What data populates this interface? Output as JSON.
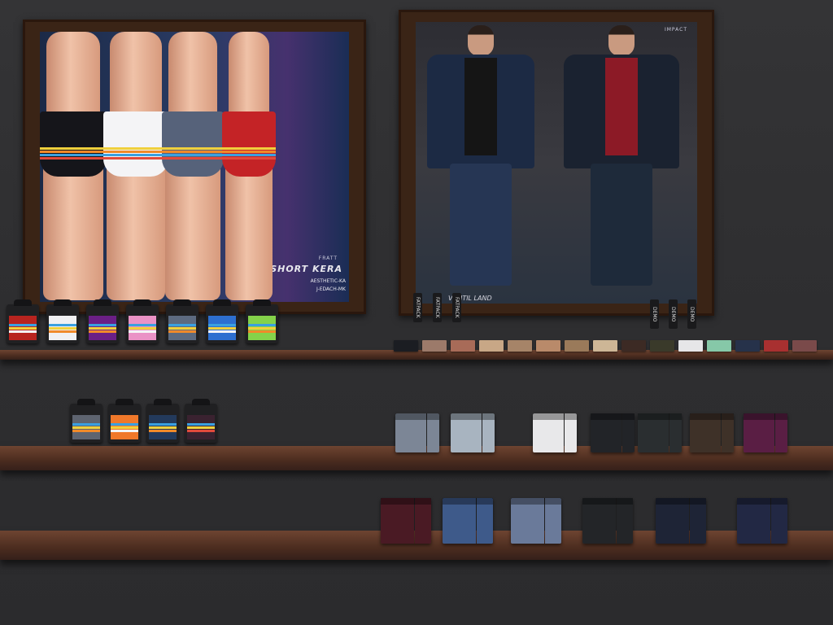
{
  "posters": [
    {
      "id": "short-kera",
      "title": "SHORT KERA",
      "subtitle_1": "AESTHETIC-KA",
      "subtitle_2": "J-EDACH-MK",
      "brand": "FRATT",
      "brief_colors": [
        "#15151a",
        "#f4f4f6",
        "#56627a",
        "#c42326"
      ],
      "stripe_colors": [
        "#f0d03c",
        "#f08a2a",
        "#3aa0e0",
        "#e04a3c"
      ]
    },
    {
      "id": "jeans-jacket",
      "brand": "IMPACT",
      "caption": "VUNTIL LAND",
      "outfits": [
        {
          "jacket": "#1c2a44",
          "shirt": "#151515",
          "jeans": "#263654"
        },
        {
          "jacket": "#1a2230",
          "shirt": "#8c1a26",
          "jeans": "#1e2a3a"
        }
      ]
    }
  ],
  "shelf_1": {
    "boxes": [
      {
        "color": "#b8241f",
        "stripes": [
          "#3aa0e0",
          "#f0d03c",
          "#f4f4f6"
        ]
      },
      {
        "color": "#f0f0f2",
        "stripes": [
          "#3aa0e0",
          "#f0d03c",
          "#f08a2a"
        ]
      },
      {
        "color": "#6a1f86",
        "stripes": [
          "#3aa0e0",
          "#f0d03c",
          "#f08a2a"
        ]
      },
      {
        "color": "#ea92c6",
        "stripes": [
          "#3aa0e0",
          "#f0d03c",
          "#f4f4f6"
        ]
      },
      {
        "color": "#5c6a80",
        "stripes": [
          "#3aa0e0",
          "#f0d03c",
          "#f08a2a"
        ]
      },
      {
        "color": "#2d6fd0",
        "stripes": [
          "#3aa0e0",
          "#f0d03c",
          "#f4f4f6"
        ]
      },
      {
        "color": "#84d24a",
        "stripes": [
          "#3aa0e0",
          "#f0d03c",
          "#f08a2a"
        ]
      }
    ],
    "tags_left": [
      "FATPACK",
      "FATPACK",
      "FATPACK"
    ],
    "tags_right": [
      "DEMO",
      "DEMO",
      "DEMO"
    ],
    "swatches": [
      "#1b1d22",
      "#9c7a6a",
      "#a86b58",
      "#c8a786",
      "#a68468",
      "#b98a6a",
      "#9a7a5a",
      "#cdb696",
      "#3c2a24",
      "#3a3a2a",
      "#e6e6e8",
      "#86c8a8",
      "#26324a",
      "#a83030",
      "#7a4a4a"
    ]
  },
  "shelf_2": {
    "boxes": [
      {
        "color": "#5e6470",
        "stripes": [
          "#3aa0e0",
          "#f0d03c",
          "#f08a2a"
        ]
      },
      {
        "color": "#f0782a",
        "stripes": [
          "#3aa0e0",
          "#f0d03c",
          "#f4f4f6"
        ]
      },
      {
        "color": "#233a5c",
        "stripes": [
          "#3aa0e0",
          "#f0d03c",
          "#f08a2a"
        ]
      },
      {
        "color": "#3a2230",
        "stripes": [
          "#3aa0e0",
          "#f0d03c",
          "#e04a3c"
        ]
      }
    ],
    "packs": [
      "#7c8696",
      "#a8b4c0",
      "#e8e8ea",
      "#222428",
      "#2a2e30",
      "#3e3128",
      "#5a1e44"
    ]
  },
  "shelf_3": {
    "packs": [
      "#4a1a24",
      "#3e5a8a",
      "#6a7a9a",
      "#232528",
      "#1e2436",
      "#222844"
    ]
  }
}
